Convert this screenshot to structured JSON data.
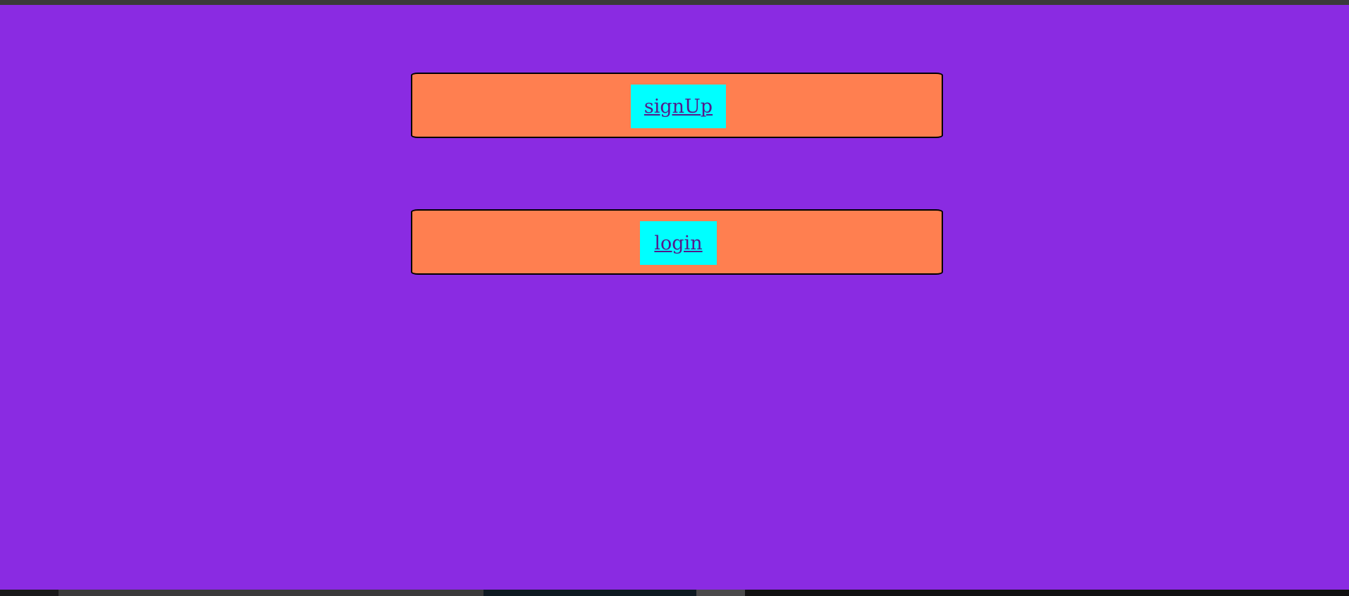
{
  "page": {
    "background_color": "#8a2be2",
    "card_color": "#ff7f50",
    "link_box_color": "#00ffff",
    "link_color": "#551a8b"
  },
  "nav": {
    "signup_label": "signUp",
    "login_label": "login"
  }
}
